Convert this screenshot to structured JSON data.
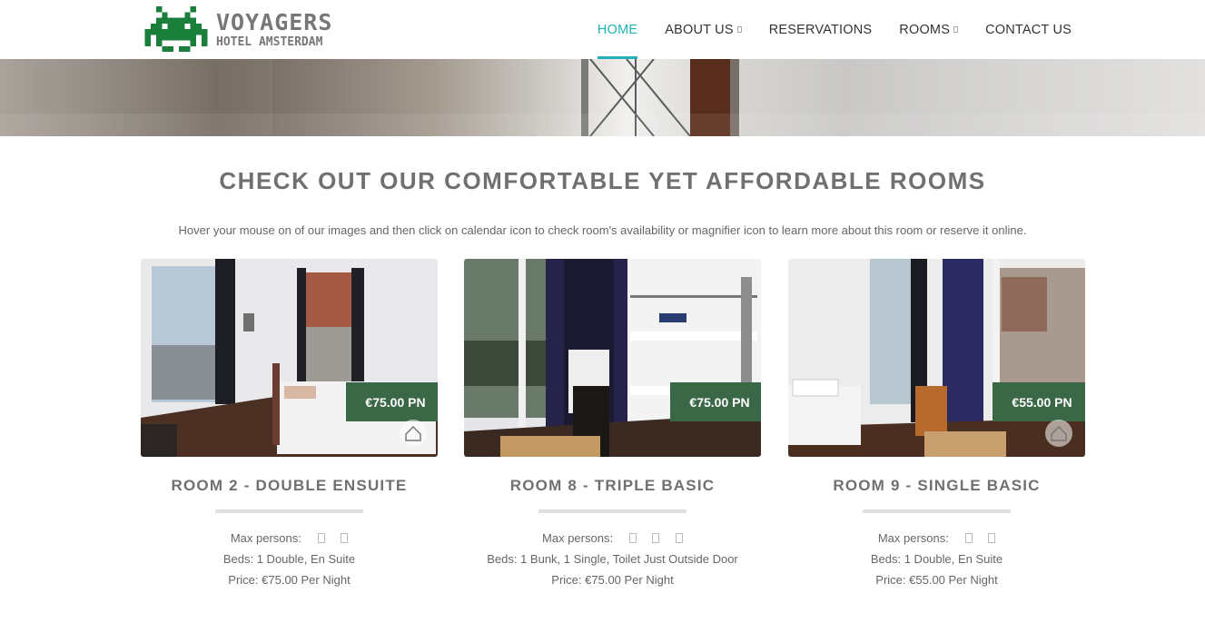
{
  "header": {
    "logo_title": "VOYAGERS",
    "logo_subtitle": "HOTEL AMSTERDAM",
    "nav": [
      {
        "label": "HOME",
        "active": true,
        "dropdown": false
      },
      {
        "label": "ABOUT US",
        "active": false,
        "dropdown": true
      },
      {
        "label": "RESERVATIONS",
        "active": false,
        "dropdown": false
      },
      {
        "label": "ROOMS",
        "active": false,
        "dropdown": true
      },
      {
        "label": "CONTACT US",
        "active": false,
        "dropdown": false
      }
    ]
  },
  "colors": {
    "accent": "#1fb1b7",
    "price_tag": "#3a6847",
    "logo_invader": "#1a7f3b"
  },
  "section": {
    "title": "CHECK OUT OUR COMFORTABLE YET AFFORDABLE ROOMS",
    "description": "Hover your mouse on of our images and then click on calendar icon to check room's availability or magnifier icon to learn more about this room or reserve it online."
  },
  "rooms": [
    {
      "price_tag": "€75.00 PN",
      "title": "ROOM 2 - DOUBLE ENSUITE",
      "max_persons_label": "Max persons:",
      "max_persons": 2,
      "beds": "Beds: 1 Double, En Suite",
      "price": "Price: €75.00 Per Night"
    },
    {
      "price_tag": "€75.00 PN",
      "title": "ROOM 8 - TRIPLE BASIC",
      "max_persons_label": "Max persons:",
      "max_persons": 3,
      "beds": "Beds: 1 Bunk, 1 Single, Toilet Just Outside Door",
      "price": "Price: €75.00 Per Night"
    },
    {
      "price_tag": "€55.00 PN",
      "title": "ROOM 9 - SINGLE BASIC",
      "max_persons_label": "Max persons:",
      "max_persons": 2,
      "beds": "Beds: 1 Double, En Suite",
      "price": "Price: €55.00 Per Night"
    }
  ]
}
